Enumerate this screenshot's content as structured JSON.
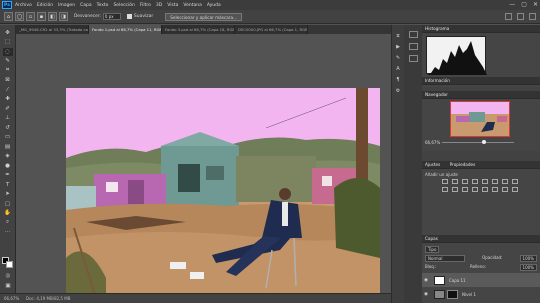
{
  "app": {
    "logo": "Ps"
  },
  "menu": [
    "Archivo",
    "Edición",
    "Imagen",
    "Capa",
    "Texto",
    "Selección",
    "Filtro",
    "3D",
    "Vista",
    "Ventana",
    "Ayuda"
  ],
  "window_controls": [
    "—",
    "▢",
    "✕"
  ],
  "options": {
    "desvanecer_label": "Desvanecer:",
    "desvanecer_value": "0 px",
    "suavizar_label": "Suavizar",
    "select_mask_label": "Seleccionar y aplicar máscara..."
  },
  "tabs": [
    {
      "label": "_MG_9946.CR2 al 33,3% (Tratado capas R...",
      "active": false
    },
    {
      "label": "Fondo 1.psd al 66,7% (Capa 11, RGB/8#) *",
      "active": true
    },
    {
      "label": "Fondo 3.psd al 66,7% (Capa 18, RGB/8) *",
      "active": false
    },
    {
      "label": "DSC0000.JPG al 66,7% (Capa 1, RGB/8#) *",
      "active": false
    }
  ],
  "status": {
    "zoom": "66,67%",
    "doc": "Doc: 4,19 MB/82,5 MB"
  },
  "panels": {
    "histogram": "Histograma",
    "info": "Información",
    "navigator": "Navegador",
    "nav_zoom": "66,67%",
    "adjustments": "Ajustes",
    "properties": "Propiedades",
    "add_adjustment": "Añadir un ajuste",
    "layers": "Capas",
    "kind": "Tipo",
    "blend_mode": "Normal",
    "opacity_label": "Opacidad:",
    "opacity_value": "100%",
    "lock_label": "Bloq.:",
    "fill_label": "Relleno:",
    "fill_value": "100%",
    "layer_items": [
      {
        "name": "Capa 11",
        "selected": true
      },
      {
        "name": "Nivel 1",
        "selected": false
      }
    ]
  },
  "colors": {
    "sky": "#f2b5f0",
    "navigator_border": "#d83a3a",
    "accent": "#31a8ff"
  }
}
